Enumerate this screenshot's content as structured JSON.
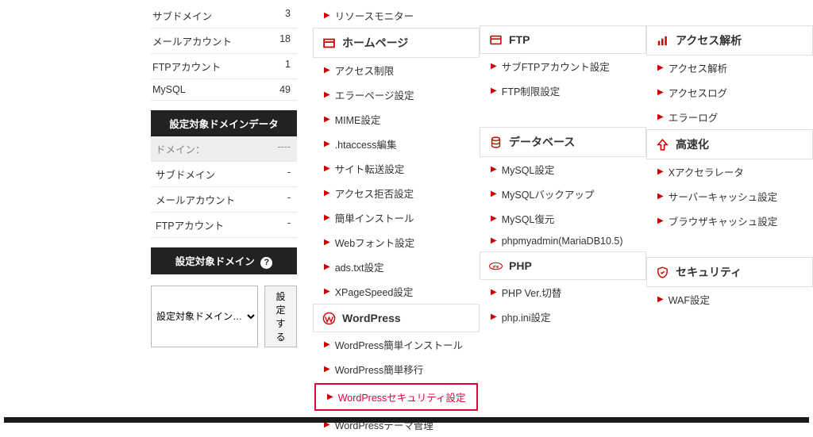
{
  "sidebar": {
    "stats": [
      {
        "label": "サブドメイン",
        "value": "3"
      },
      {
        "label": "メールアカウント",
        "value": "18"
      },
      {
        "label": "FTPアカウント",
        "value": "1"
      },
      {
        "label": "MySQL",
        "value": "49"
      }
    ],
    "domain_data_header": "設定対象ドメインデータ",
    "domain_rows": [
      {
        "label": "ドメイン：",
        "value": "----",
        "shade": true
      },
      {
        "label": "サブドメイン",
        "value": "-"
      },
      {
        "label": "メールアカウント",
        "value": "-"
      },
      {
        "label": "FTPアカウント",
        "value": "-"
      }
    ],
    "domain_select_header": "設定対象ドメイン",
    "help_mark": "?",
    "select_placeholder": "設定対象ドメイン…",
    "set_button": "設定する"
  },
  "col1_top_items": [
    "リソースモニター"
  ],
  "homepage": {
    "title": "ホームページ",
    "items": [
      "アクセス制限",
      "エラーページ設定",
      "MIME設定",
      ".htaccess編集",
      "サイト転送設定",
      "アクセス拒否設定",
      "簡単インストール",
      "Webフォント設定",
      "ads.txt設定",
      "XPageSpeed設定"
    ]
  },
  "wordpress": {
    "title": "WordPress",
    "items": [
      "WordPress簡単インストール",
      "WordPress簡単移行",
      "WordPressセキュリティ設定",
      "WordPressテーマ管理"
    ],
    "highlight_index": 2
  },
  "ftp": {
    "title": "FTP",
    "items": [
      "サブFTPアカウント設定",
      "FTP制限設定"
    ]
  },
  "database": {
    "title": "データベース",
    "items": [
      "MySQL設定",
      "MySQLバックアップ",
      "MySQL復元",
      "phpmyadmin(MariaDB10.5)"
    ]
  },
  "php": {
    "title": "PHP",
    "items": [
      "PHP Ver.切替",
      "php.ini設定"
    ]
  },
  "analytics": {
    "title": "アクセス解析",
    "items": [
      "アクセス解析",
      "アクセスログ",
      "エラーログ"
    ]
  },
  "speed": {
    "title": "高速化",
    "items": [
      "Xアクセラレータ",
      "サーバーキャッシュ設定",
      "ブラウザキャッシュ設定"
    ]
  },
  "security": {
    "title": "セキュリティ",
    "items": [
      "WAF設定"
    ]
  }
}
